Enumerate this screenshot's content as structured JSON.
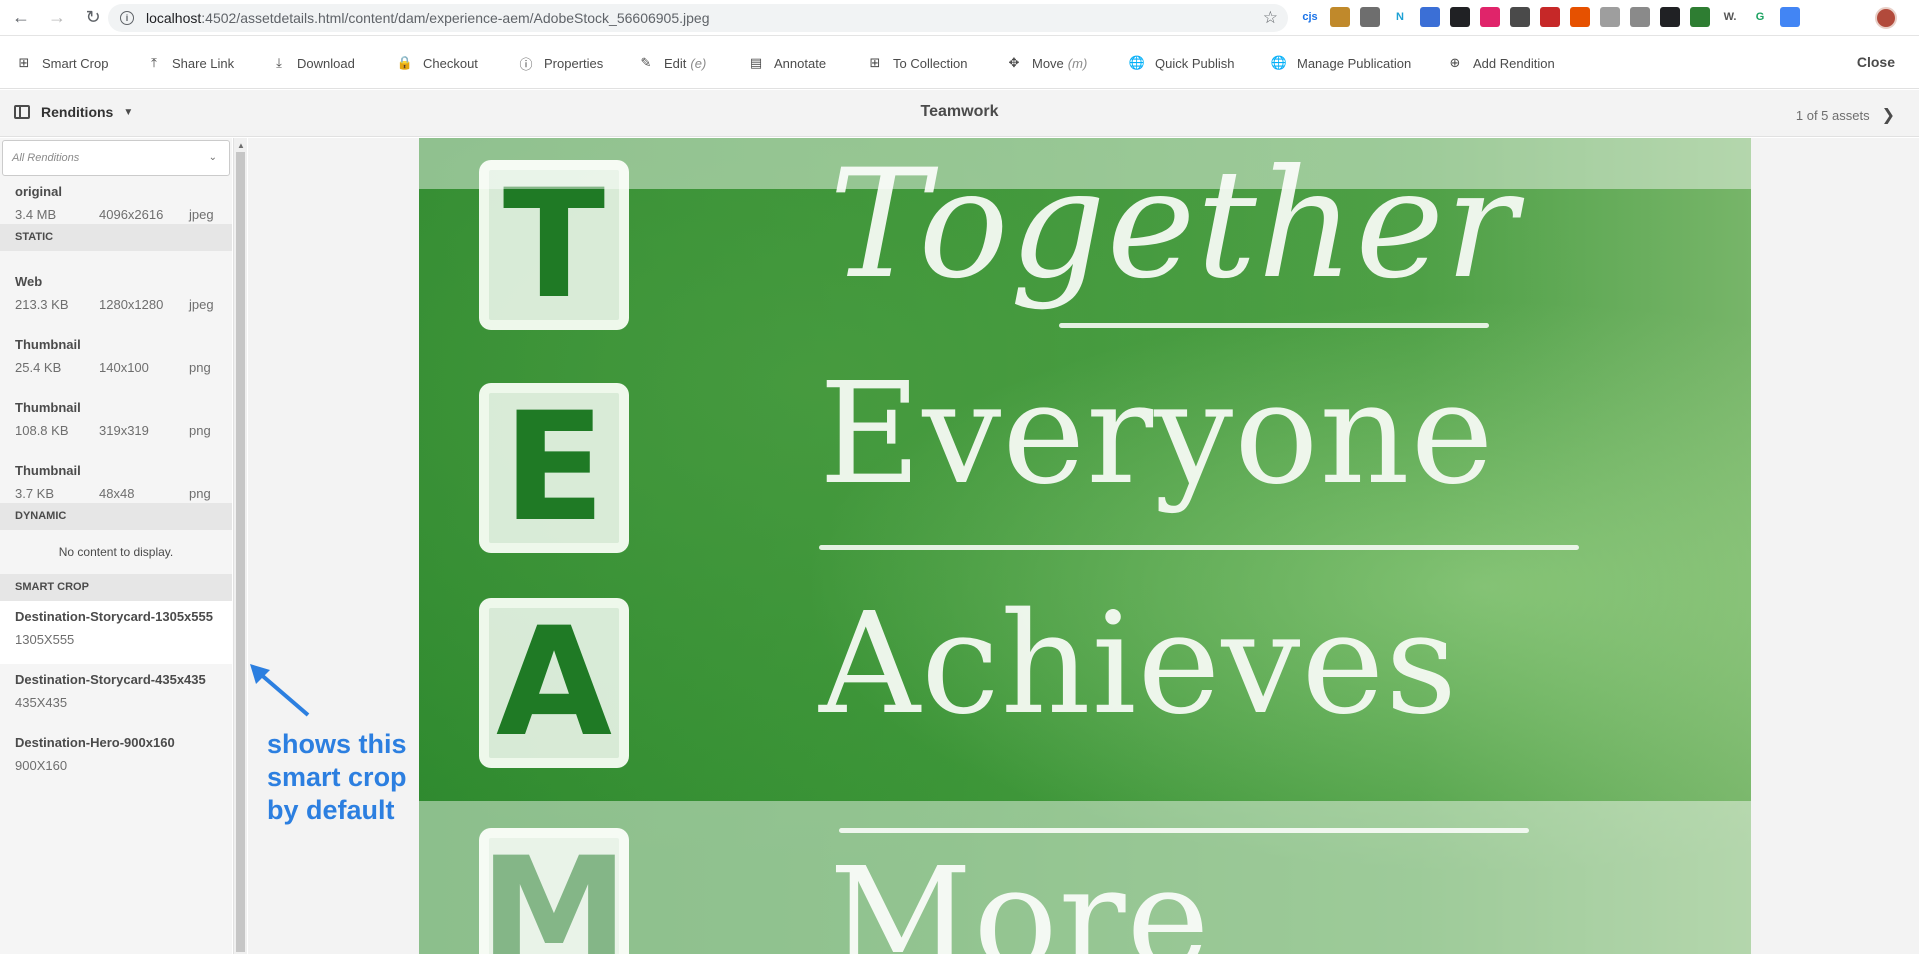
{
  "browser": {
    "url_host": "localhost",
    "url_path": ":4502/assetdetails.html/content/dam/experience-aem/AdobeStock_56606905.jpeg",
    "extensions": [
      {
        "icon": "cjs-icon",
        "text": "cjs",
        "color": "#1a73e8"
      },
      {
        "icon": "pen-icon",
        "text": "",
        "color": "#c0892b"
      },
      {
        "icon": "circle-icon",
        "text": "",
        "color": "#6e6e6e"
      },
      {
        "icon": "n-icon",
        "text": "N",
        "color": "#1da1d4"
      },
      {
        "icon": "blue-circle-icon",
        "text": "",
        "color": "#3b6fd6"
      },
      {
        "icon": "spy-icon",
        "text": "",
        "color": "#202124"
      },
      {
        "icon": "pink-ring-icon",
        "text": "",
        "color": "#e0246a"
      },
      {
        "icon": "drive-icon",
        "text": "",
        "color": "#4a4a4a"
      },
      {
        "icon": "red-square-icon",
        "text": "",
        "color": "#c62828"
      },
      {
        "icon": "target-icon",
        "text": "",
        "color": "#e65100"
      },
      {
        "icon": "check-icon",
        "text": "",
        "color": "#9e9e9e"
      },
      {
        "icon": "box-icon",
        "text": "",
        "color": "#8a8a8a"
      },
      {
        "icon": "robot-icon",
        "text": "",
        "color": "#202124"
      },
      {
        "icon": "leaf-icon",
        "text": "",
        "color": "#2e7d32"
      },
      {
        "icon": "w-icon",
        "text": "W.",
        "color": "#555555"
      },
      {
        "icon": "g-icon",
        "text": "G",
        "color": "#1aa260"
      },
      {
        "icon": "refresh-g-icon",
        "text": "",
        "color": "#4285f4"
      }
    ]
  },
  "actions": [
    {
      "label": "Smart Crop",
      "hint": "",
      "icon": "smart-crop-icon"
    },
    {
      "label": "Share Link",
      "hint": "",
      "icon": "share-icon"
    },
    {
      "label": "Download",
      "hint": "",
      "icon": "download-icon"
    },
    {
      "label": "Checkout",
      "hint": "",
      "icon": "lock-icon"
    },
    {
      "label": "Properties",
      "hint": "",
      "icon": "info-icon"
    },
    {
      "label": "Edit",
      "hint": "(e)",
      "icon": "pencil-icon"
    },
    {
      "label": "Annotate",
      "hint": "",
      "icon": "comment-icon"
    },
    {
      "label": "To Collection",
      "hint": "",
      "icon": "collection-icon"
    },
    {
      "label": "Move",
      "hint": "(m)",
      "icon": "move-icon"
    },
    {
      "label": "Quick Publish",
      "hint": "",
      "icon": "globe-icon"
    },
    {
      "label": "Manage Publication",
      "hint": "",
      "icon": "globe-gear-icon"
    },
    {
      "label": "Add Rendition",
      "hint": "",
      "icon": "add-icon"
    }
  ],
  "close_label": "Close",
  "titlebar": {
    "rail_label": "Renditions",
    "title": "Teamwork",
    "pager": "1 of 5 assets"
  },
  "rail": {
    "filter_placeholder": "All Renditions",
    "original": {
      "name": "original",
      "size": "3.4 MB",
      "dim": "4096x2616",
      "type": "jpeg"
    },
    "static_header": "STATIC",
    "static": [
      {
        "name": "Web",
        "size": "213.3 KB",
        "dim": "1280x1280",
        "type": "jpeg"
      },
      {
        "name": "Thumbnail",
        "size": "25.4 KB",
        "dim": "140x100",
        "type": "png"
      },
      {
        "name": "Thumbnail",
        "size": "108.8 KB",
        "dim": "319x319",
        "type": "png"
      },
      {
        "name": "Thumbnail",
        "size": "3.7 KB",
        "dim": "48x48",
        "type": "png"
      }
    ],
    "dynamic_header": "DYNAMIC",
    "dynamic_empty": "No content to display.",
    "smartcrop_header": "SMART CROP",
    "smartcrop": [
      {
        "name": "Destination-Storycard-1305x555",
        "dim": "1305X555"
      },
      {
        "name": "Destination-Storycard-435x435",
        "dim": "435X435"
      },
      {
        "name": "Destination-Hero-900x160",
        "dim": "900X160"
      }
    ]
  },
  "annotation": {
    "line1": "shows this",
    "line2": "smart crop",
    "line3": "by default",
    "color": "#2c7fe0"
  }
}
